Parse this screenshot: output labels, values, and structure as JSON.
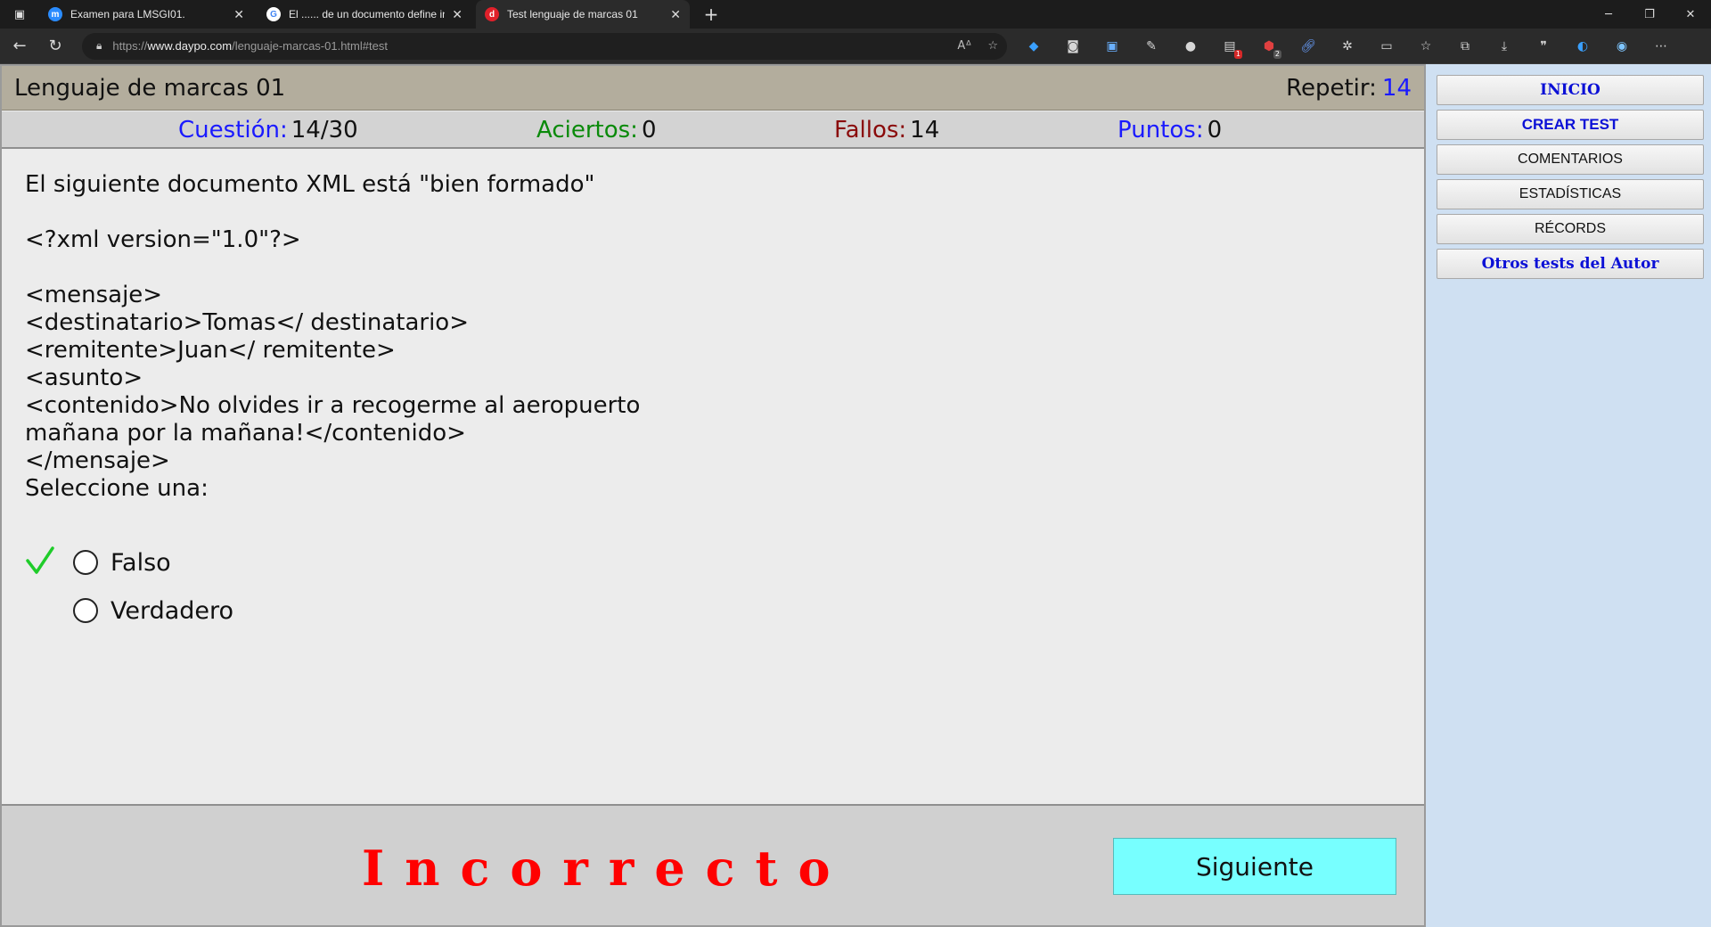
{
  "browser": {
    "tabs": [
      {
        "title": "Examen para LMSGI01.",
        "favicon_color": "#2a8cff"
      },
      {
        "title": "El ...... de un documento define in",
        "favicon_color": "#ffffff"
      },
      {
        "title": "Test lenguaje de marcas 01",
        "favicon_color": "#e0202a"
      }
    ],
    "new_tab": "+",
    "url_prefix": "https://",
    "url_host": "www.daypo.com",
    "url_path": "/lenguaje-marcas-01.html#test"
  },
  "header": {
    "title": "Lenguaje de marcas 01",
    "repeat_label": "Repetir:",
    "repeat_value": "14"
  },
  "stats": {
    "question_label": "Cuestión:",
    "question_value": "14/30",
    "correct_label": "Aciertos:",
    "correct_value": "0",
    "wrong_label": "Fallos:",
    "wrong_value": "14",
    "points_label": "Puntos:",
    "points_value": "0",
    "colors": {
      "question": "#1a1aff",
      "correct": "#0a8a0a",
      "wrong": "#8a0a0a",
      "points": "#1a1aff"
    }
  },
  "question": {
    "text": "El siguiente documento XML está \"bien formado\"\n\n<?xml version=\"1.0\"?>\n\n<mensaje>\n<destinatario>Tomas</ destinatario>\n<remitente>Juan</ remitente>\n<asunto>\n<contenido>No olvides ir a recogerme al aeropuerto\nmañana por la mañana!</contenido>\n</mensaje>\nSeleccione una:"
  },
  "answers": [
    {
      "label": "Falso",
      "correct": true
    },
    {
      "label": "Verdadero",
      "correct": false
    }
  ],
  "result": {
    "text": "Incorrecto",
    "color": "#ff0000"
  },
  "next_button": "Siguiente",
  "sidebar": {
    "items": [
      {
        "label": "INICIO"
      },
      {
        "label": "CREAR TEST"
      },
      {
        "label": "COMENTARIOS"
      },
      {
        "label": "ESTADÍSTICAS"
      },
      {
        "label": "RÉCORDS"
      },
      {
        "label": "Otros tests del Autor"
      }
    ]
  }
}
